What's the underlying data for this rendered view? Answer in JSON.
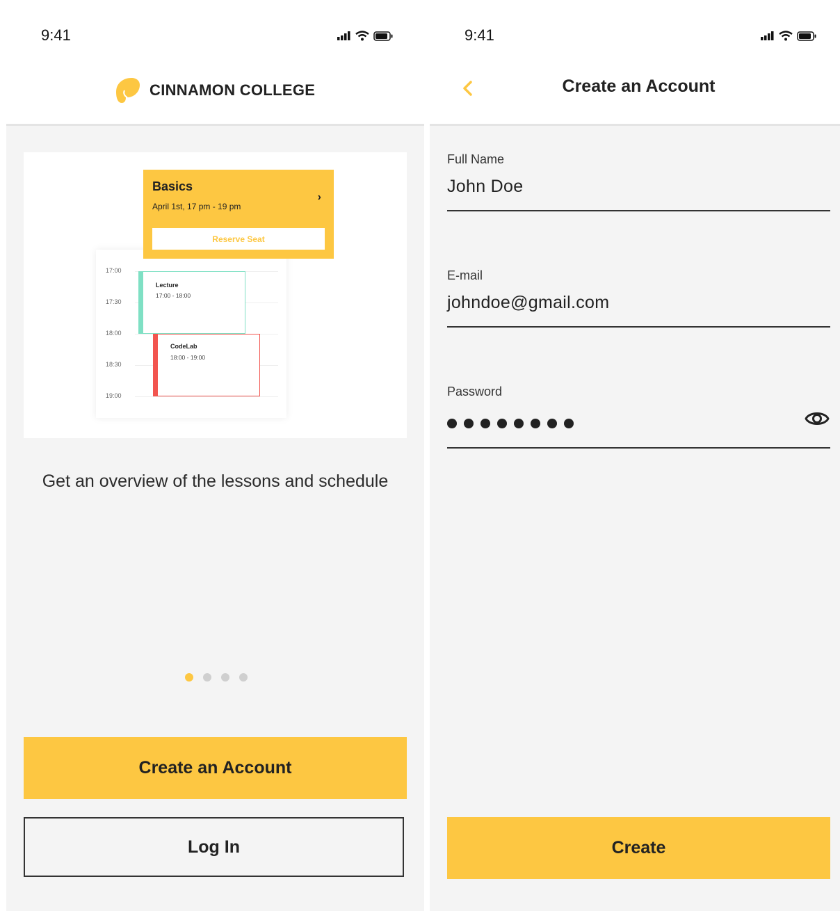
{
  "left_screen": {
    "status_bar": {
      "time": "9:41",
      "icons": [
        "signal-icon",
        "wifi-icon",
        "battery-icon"
      ]
    },
    "header": {
      "brand_name": "CINNAMON COLLEGE",
      "logo_icon": "cinnamon-logo-icon"
    },
    "illustration": {
      "promo_card": {
        "title": "Basics",
        "date": "April 1st, 17 pm - 19 pm",
        "button_label": "Reserve Seat",
        "chevron_icon": "chevron-right-icon"
      },
      "calendar": {
        "times": [
          "17:00",
          "17:30",
          "18:00",
          "18:30",
          "19:00"
        ],
        "events": [
          {
            "title": "Lecture",
            "time": "17:00 - 18:00",
            "color": "#7fe0c4"
          },
          {
            "title": "CodeLab",
            "time": "18:00 - 19:00",
            "color": "#f2554f"
          }
        ]
      }
    },
    "onboarding_text": "Get an overview of the lessons and schedule",
    "pagination": {
      "pages": 4,
      "active": 1
    },
    "buttons": {
      "create_account": "Create an Account",
      "log_in": "Log In"
    }
  },
  "right_screen": {
    "status_bar": {
      "time": "9:41",
      "icons": [
        "signal-icon",
        "wifi-icon",
        "battery-icon"
      ]
    },
    "header": {
      "title": "Create an Account",
      "back_icon": "chevron-left-icon"
    },
    "form": {
      "full_name": {
        "label": "Full Name",
        "value": "John Doe"
      },
      "email": {
        "label": "E-mail",
        "value": "johndoe@gmail.com"
      },
      "password": {
        "label": "Password",
        "masked_length": 8,
        "toggle_icon": "eye-icon"
      }
    },
    "submit_label": "Create"
  },
  "colors": {
    "accent": "#fdc742",
    "background": "#f4f4f4",
    "header": "#ffffff",
    "text": "#222222",
    "lecture": "#7fe0c4",
    "codelab": "#f2554f"
  }
}
